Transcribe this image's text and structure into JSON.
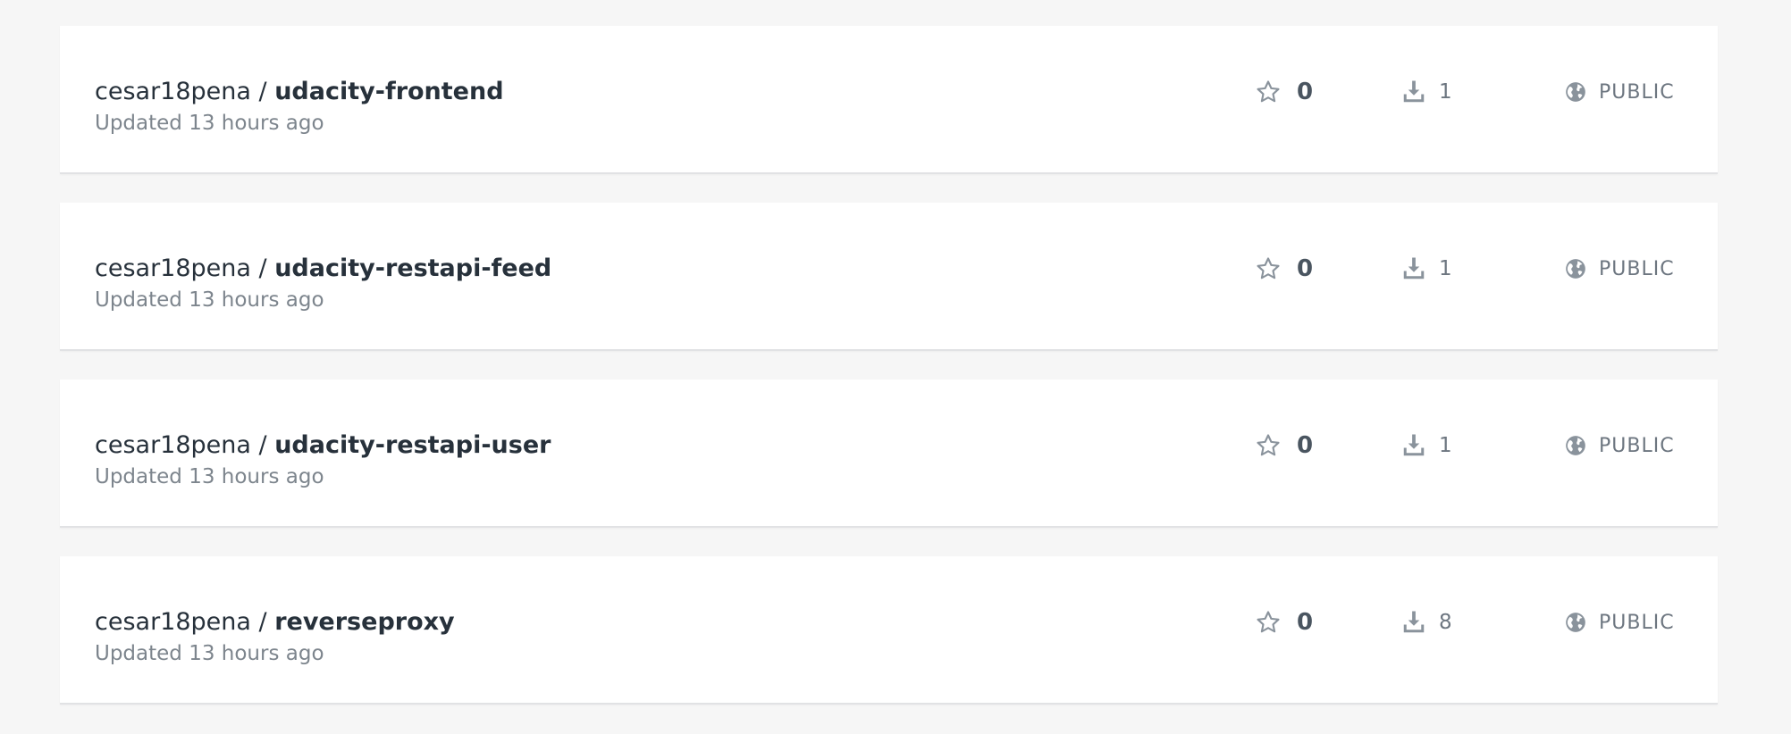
{
  "repositories": [
    {
      "owner": "cesar18pena",
      "separator": " / ",
      "name": "udacity-frontend",
      "updated": "Updated 13 hours ago",
      "stars": "0",
      "pulls": "1",
      "visibility": "PUBLIC"
    },
    {
      "owner": "cesar18pena",
      "separator": " / ",
      "name": "udacity-restapi-feed",
      "updated": "Updated 13 hours ago",
      "stars": "0",
      "pulls": "1",
      "visibility": "PUBLIC"
    },
    {
      "owner": "cesar18pena",
      "separator": " / ",
      "name": "udacity-restapi-user",
      "updated": "Updated 13 hours ago",
      "stars": "0",
      "pulls": "1",
      "visibility": "PUBLIC"
    },
    {
      "owner": "cesar18pena",
      "separator": " / ",
      "name": "reverseproxy",
      "updated": "Updated 13 hours ago",
      "stars": "0",
      "pulls": "8",
      "visibility": "PUBLIC"
    }
  ],
  "icons": {
    "star": "star-icon",
    "pulls": "download-icon",
    "visibility": "globe-icon"
  },
  "colors": {
    "background": "#f6f6f6",
    "card": "#ffffff",
    "title": "#27313b",
    "muted": "#7d858d",
    "icon": "#8a939c"
  }
}
